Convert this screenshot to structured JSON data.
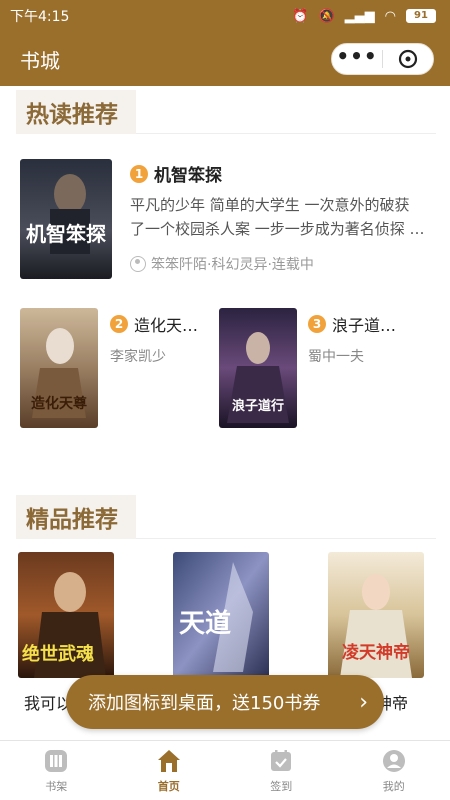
{
  "status_bar": {
    "time": "下午4:15",
    "battery": "91"
  },
  "nav": {
    "title": "书城"
  },
  "hot": {
    "heading": "热读推荐",
    "featured": {
      "rank": "1",
      "title": "机智笨探",
      "description_line1": "平凡的少年 简单的大学生 一次意外的破获",
      "description_line2": "了一个校园杀人案 一步一步成为著名侦探 …",
      "meta": "笨笨阡陌·科幻灵异·连载中",
      "cover_text": "机智笨探"
    },
    "others": [
      {
        "rank": "2",
        "title": "造化天…",
        "author": "李家凯少",
        "cover_text": "造化天尊"
      },
      {
        "rank": "3",
        "title": "浪子道…",
        "author": "蜀中一夫",
        "cover_text": "浪子道行"
      }
    ]
  },
  "premium": {
    "heading": "精品推荐",
    "books": [
      {
        "title_visible": "我可以",
        "cover_text": "绝世武魂"
      },
      {
        "title_visible": "",
        "cover_text": "天道"
      },
      {
        "title_visible": "神帝",
        "cover_text": "凌天神帝"
      }
    ]
  },
  "toast": {
    "text": "添加图标到桌面，送150书券",
    "arrow": "›"
  },
  "tabs": [
    {
      "label": "书架",
      "icon": "bookshelf-icon"
    },
    {
      "label": "首页",
      "icon": "home-icon",
      "active": true
    },
    {
      "label": "签到",
      "icon": "calendar-icon"
    },
    {
      "label": "我的",
      "icon": "user-icon"
    }
  ],
  "colors": {
    "brand": "#9a6f2c",
    "rank": "#f2a23a",
    "heading": "#8c6a38"
  }
}
